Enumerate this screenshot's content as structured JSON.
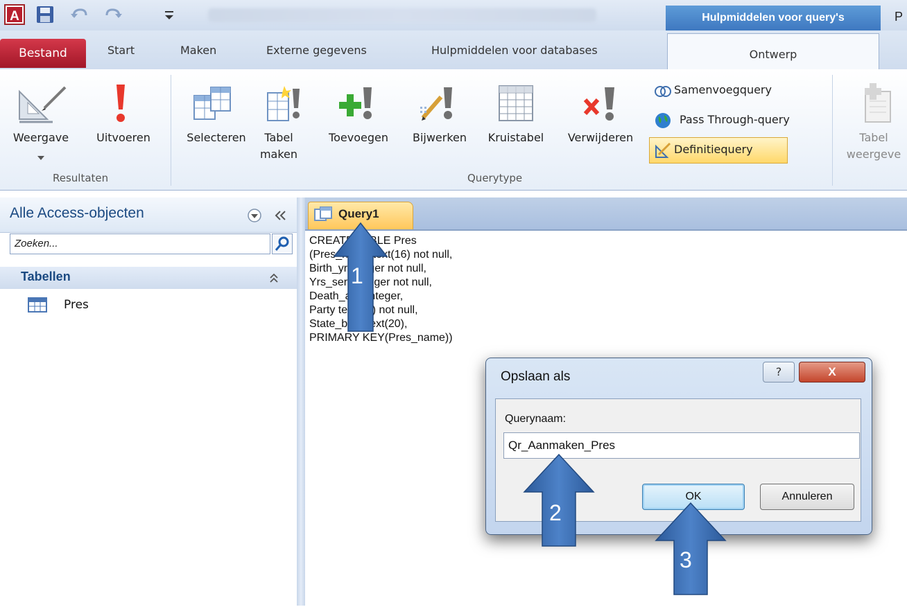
{
  "app": {
    "context_tab": "Hulpmiddelen voor query's",
    "title_fragment": "P"
  },
  "tabs": [
    {
      "label": "Bestand"
    },
    {
      "label": "Start"
    },
    {
      "label": "Maken"
    },
    {
      "label": "Externe gegevens"
    },
    {
      "label": "Hulpmiddelen voor databases"
    },
    {
      "label": "Ontwerp"
    }
  ],
  "ribbon": {
    "results_group": "Resultaten",
    "querytype_group": "Querytype",
    "buttons": {
      "view": "Weergave",
      "run": "Uitvoeren",
      "select": "Selecteren",
      "make_table_1": "Tabel",
      "make_table_2": "maken",
      "append": "Toevoegen",
      "update": "Bijwerken",
      "crosstab": "Kruistabel",
      "delete": "Verwijderen",
      "union": "Samenvoegquery",
      "pass_through": "Pass Through-query",
      "data_definition": "Definitiequery",
      "show_table_1": "Tabel",
      "show_table_2": "weergeve"
    }
  },
  "nav": {
    "title": "Alle Access-objecten",
    "search_placeholder": "Zoeken...",
    "group_label": "Tabellen",
    "items": [
      {
        "label": "Pres"
      }
    ]
  },
  "document": {
    "tab_label": "Query1",
    "sql": "CREATE TABLE Pres\n(Pres_name text(16) not null,\nBirth_yr integer not null,\nYrs_serv integer not null,\nDeath_age integer,\nParty text(15) not null,\nState_born text(20),\nPRIMARY KEY(Pres_name))"
  },
  "dialog": {
    "title": "Opslaan als",
    "help_glyph": "?",
    "close_glyph": "X",
    "field_label": "Querynaam:",
    "field_value": "Qr_Aanmaken_Pres",
    "ok_label": "OK",
    "cancel_label": "Annuleren"
  },
  "annotations": [
    {
      "number": "1"
    },
    {
      "number": "2"
    },
    {
      "number": "3"
    }
  ],
  "colors": {
    "accent": "#3e78c0",
    "file_tab": "#b8202f",
    "selected_doc_tab": "#ffc75b",
    "arrow": "#3f6fae"
  }
}
